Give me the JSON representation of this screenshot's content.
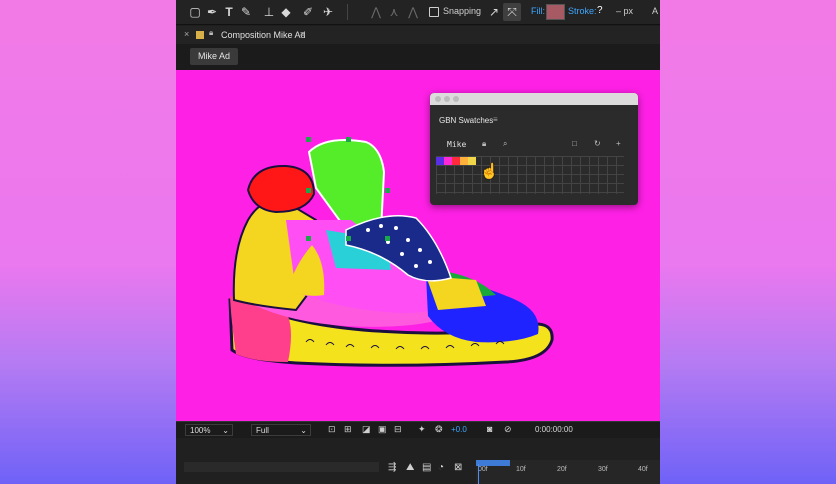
{
  "toolbar": {
    "icons": [
      "selection-tool-icon",
      "pen-tool-icon",
      "type-tool-icon",
      "brush-tool-icon",
      "clone-stamp-icon",
      "eraser-icon",
      "roto-brush-icon",
      "puppet-pin-icon"
    ],
    "snapping_label": "Snapping",
    "fill_label": "Fill:",
    "stroke_label": "Stroke:",
    "stroke_value": "?",
    "stroke_width": "– px",
    "overflow_label": "A"
  },
  "composition": {
    "panel_title": "Composition Mike Ad",
    "tab_label": "Mike Ad"
  },
  "swatches_panel": {
    "title": "GBN Swatches",
    "set_name": "Mike",
    "swatches": [
      "#5a2de6",
      "#ff2ad6",
      "#ff2a3c",
      "#ffb13b",
      "#f2d64a"
    ]
  },
  "viewer_bar": {
    "zoom": "100%",
    "resolution": "Full",
    "exposure": "+0.0",
    "timecode": "0:00:00:00"
  },
  "timeline": {
    "ticks": [
      "00f",
      "10f",
      "20f",
      "30f",
      "40f"
    ]
  },
  "colors": {
    "canvas_background": "#ff20e6",
    "accent_blue": "#3ea6ff"
  }
}
